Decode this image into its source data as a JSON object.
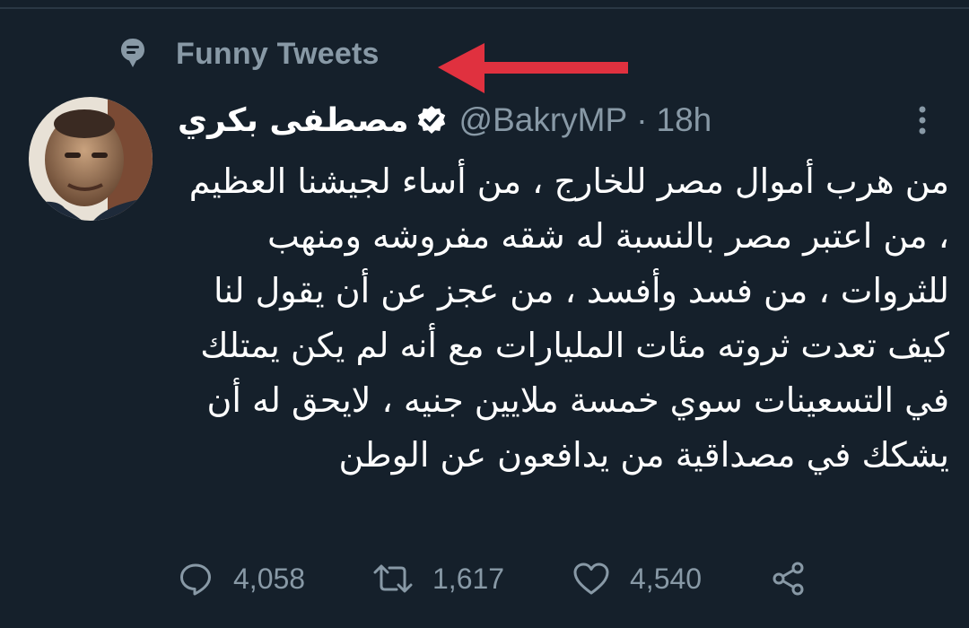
{
  "context": {
    "icon": "topic-icon",
    "label": "Funny Tweets"
  },
  "annotation": {
    "arrow_color": "#e0313f"
  },
  "tweet": {
    "author": {
      "display_name": "مصطفى بكري",
      "verified": true,
      "handle": "@BakryMP",
      "separator": "·",
      "timestamp": "18h"
    },
    "text": "من هرب أموال مصر للخارج ، من أساء لجيشنا العظيم ، من اعتبر مصر بالنسبة له شقه مفروشه ومنهب للثروات ، من فسد وأفسد ، من عجز عن أن يقول لنا كيف تعدت ثروته مئات المليارات مع أنه لم يكن يمتلك في التسعينات سوي خمسة ملايين جنيه ، لايحق له أن يشكك في مصداقية من يدافعون عن الوطن",
    "stats": {
      "replies": "4,058",
      "retweets": "1,617",
      "likes": "4,540"
    }
  },
  "colors": {
    "background": "#15202b",
    "secondary_text": "#8899a6",
    "primary_text": "#ffffff"
  }
}
